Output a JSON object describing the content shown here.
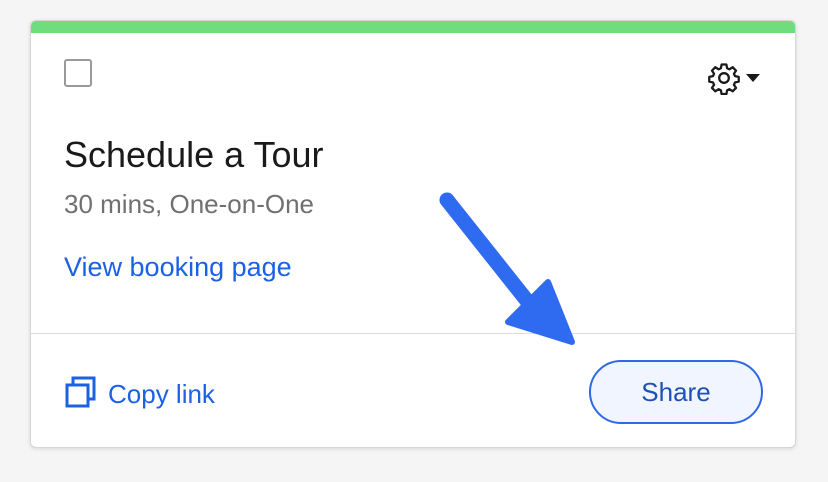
{
  "card": {
    "accent_color": "#6fdc7e",
    "title": "Schedule a Tour",
    "subtitle": "30 mins, One-on-One",
    "booking_link_label": "View booking page",
    "copy_link_label": "Copy link",
    "share_label": "Share",
    "checkbox_checked": false,
    "icons": [
      "gear-icon",
      "caret-down-icon",
      "copy-icon"
    ]
  },
  "link_color": "#1a61e6",
  "annotation_arrow_color": "#2f6bf0"
}
